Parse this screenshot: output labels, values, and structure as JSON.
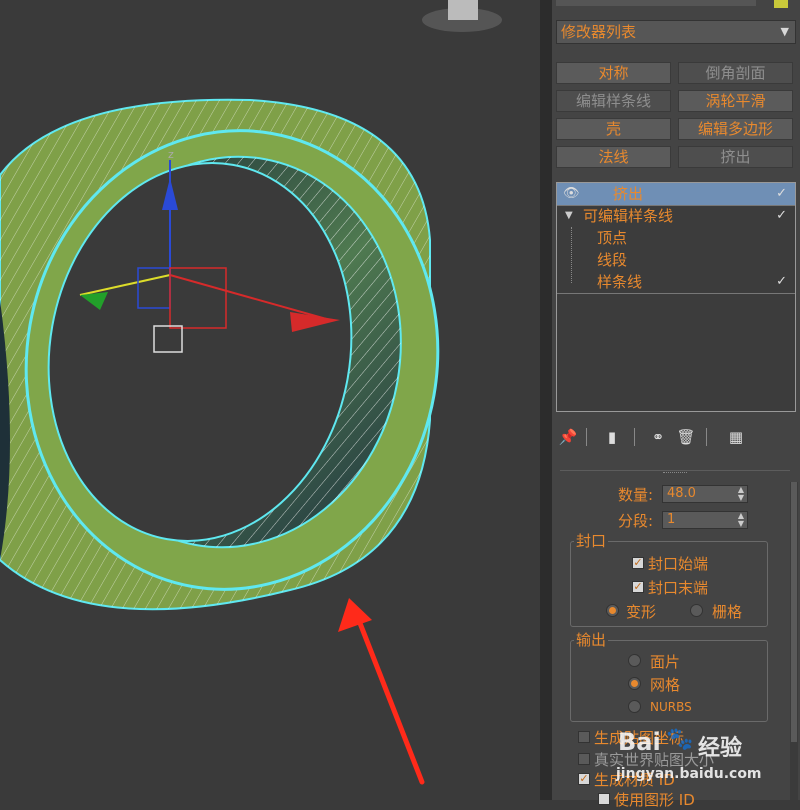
{
  "modifier_list": {
    "label": "修改器列表",
    "arrow": "▼"
  },
  "buttons": [
    {
      "label": "对称",
      "state": "on"
    },
    {
      "label": "倒角剖面",
      "state": "off"
    },
    {
      "label": "编辑样条线",
      "state": "off"
    },
    {
      "label": "涡轮平滑",
      "state": "on"
    },
    {
      "label": "壳",
      "state": "on"
    },
    {
      "label": "编辑多边形",
      "state": "on"
    },
    {
      "label": "法线",
      "state": "on"
    },
    {
      "label": "挤出",
      "state": "off"
    }
  ],
  "stack": {
    "items": [
      {
        "label": "挤出",
        "selected": true
      },
      {
        "label": "可编辑样条线",
        "selected": false
      },
      {
        "label": "顶点",
        "selected": false
      },
      {
        "label": "线段",
        "selected": false
      },
      {
        "label": "样条线",
        "selected": false
      }
    ]
  },
  "params": {
    "amount_label": "数量:",
    "amount_value": "48.0",
    "segments_label": "分段:",
    "segments_value": "1",
    "capping": {
      "title": "封口",
      "cap_start": "封口始端",
      "cap_end": "封口末端",
      "morph": "变形",
      "grid": "栅格"
    },
    "output": {
      "title": "输出",
      "patch": "面片",
      "mesh": "网格",
      "nurbs": "NURBS"
    },
    "gen_mapping": "生成贴图坐标",
    "real_world": "真实世界贴图大小",
    "gen_mat_ids": "生成材质 ID",
    "use_shape_ids": "使用图形 ID"
  },
  "watermark": {
    "brand": "Bai",
    "brand2": "经验",
    "url": "jingyan.baidu.com"
  },
  "colors": {
    "accent": "#e8892e",
    "selection": "#6f8fb5",
    "ring": "#7fa048",
    "outline": "#5fe8f0",
    "arrow": "#ff2a1a"
  }
}
